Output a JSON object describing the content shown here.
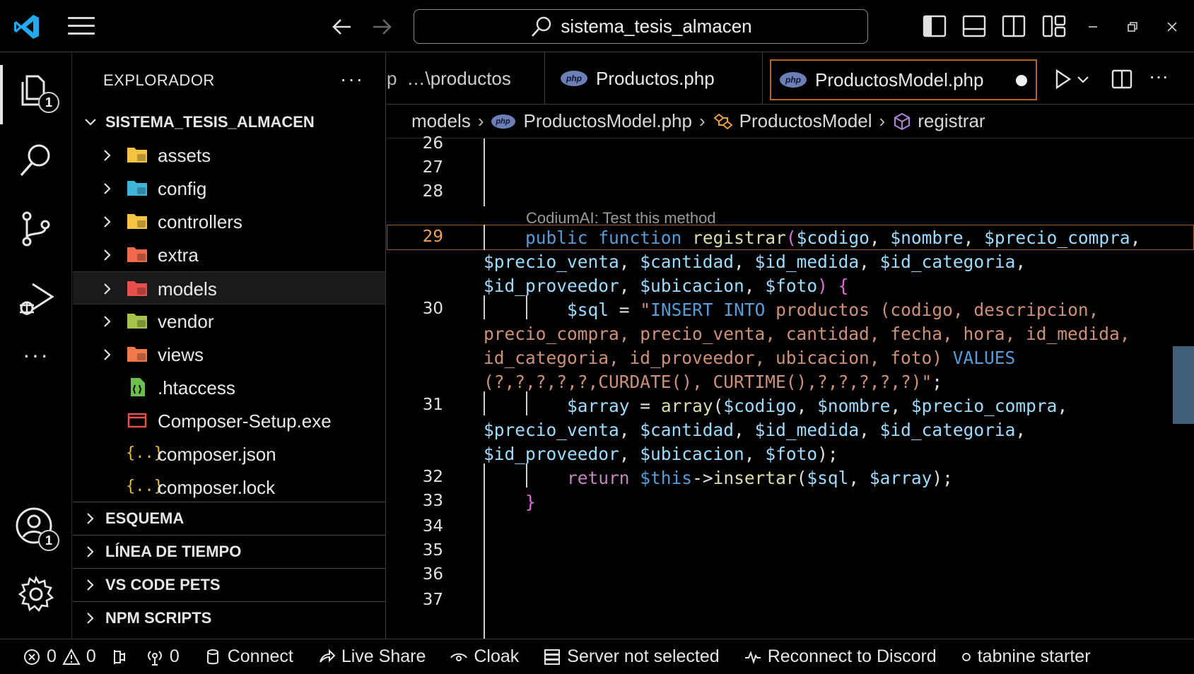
{
  "titlebar": {
    "search": "sistema_tesis_almacen"
  },
  "activity": {
    "explorer_badge": "1",
    "accounts_badge": "1"
  },
  "sidebar": {
    "title": "EXPLORADOR",
    "more": "···",
    "root": "SISTEMA_TESIS_ALMACEN",
    "items": [
      {
        "label": "assets",
        "type": "folder",
        "icon": "folder-assets-icon",
        "color": "#f5c542"
      },
      {
        "label": "config",
        "type": "folder",
        "icon": "folder-config-icon",
        "color": "#3fb4d8"
      },
      {
        "label": "controllers",
        "type": "folder",
        "icon": "folder-controllers-icon",
        "color": "#f5c542"
      },
      {
        "label": "extra",
        "type": "folder",
        "icon": "folder-extra-icon",
        "color": "#f06a4c"
      },
      {
        "label": "models",
        "type": "folder",
        "icon": "folder-models-icon",
        "color": "#e8504a"
      },
      {
        "label": "vendor",
        "type": "folder",
        "icon": "folder-vendor-icon",
        "color": "#a6c44a"
      },
      {
        "label": "views",
        "type": "folder",
        "icon": "folder-views-icon",
        "color": "#f07a4c"
      },
      {
        "label": ".htaccess",
        "type": "file",
        "icon": "htaccess-file-icon",
        "color": "#6cbf4a"
      },
      {
        "label": "Composer-Setup.exe",
        "type": "file",
        "icon": "exe-file-icon",
        "color": "#e8504a"
      },
      {
        "label": "composer.json",
        "type": "file",
        "icon": "json-file-icon",
        "color": "#e6b84a"
      },
      {
        "label": "composer.lock",
        "type": "file",
        "icon": "lock-file-icon",
        "color": "#e6b84a"
      }
    ],
    "sections": [
      "ESQUEMA",
      "LÍNEA DE TIEMPO",
      "VS CODE PETS",
      "NPM SCRIPTS"
    ]
  },
  "tabs": [
    {
      "label": "…\\productos",
      "prefix": "p"
    },
    {
      "label": "Productos.php"
    },
    {
      "label": "ProductosModel.php",
      "active": true,
      "dirty": true
    }
  ],
  "breadcrumb": {
    "folder": "models",
    "file": "ProductosModel.php",
    "class": "ProductosModel",
    "method": "registrar"
  },
  "codelens": "CodiumAI: Test this method",
  "line_numbers": [
    "26",
    "27",
    "28",
    "29",
    "30",
    "31",
    "32",
    "33",
    "34",
    "35",
    "36",
    "37"
  ],
  "current_line": "29",
  "statusbar": {
    "errors": "0",
    "warnings": "0",
    "ports": "0",
    "connect": "Connect",
    "live_share": "Live Share",
    "cloak": "Cloak",
    "server": "Server not selected",
    "discord": "Reconnect to Discord",
    "tabnine": "tabnine starter"
  }
}
